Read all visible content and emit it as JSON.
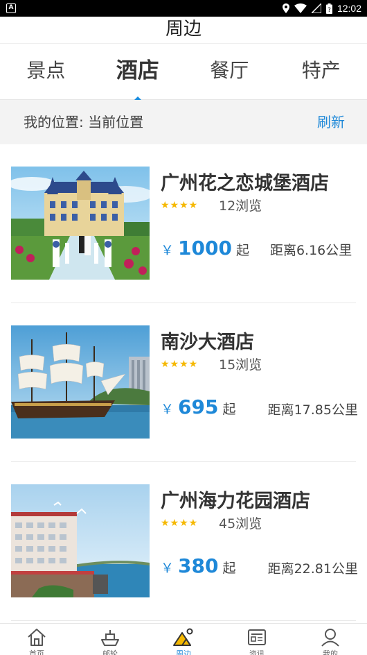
{
  "status_bar": {
    "time": "12:02",
    "app_icon": "A"
  },
  "header": {
    "title": "周边"
  },
  "tabs": [
    {
      "label": "景点",
      "active": false
    },
    {
      "label": "酒店",
      "active": true
    },
    {
      "label": "餐厅",
      "active": false
    },
    {
      "label": "特产",
      "active": false
    }
  ],
  "location": {
    "text": "我的位置: 当前位置",
    "refresh_label": "刷新"
  },
  "hotels": [
    {
      "name": "广州花之恋城堡酒店",
      "rating": 4,
      "views": "12浏览",
      "currency": "￥",
      "price": "1000",
      "price_suffix": "起",
      "distance": "距离6.16公里",
      "image": "castle-hotel-wedding-photo"
    },
    {
      "name": "南沙大酒店",
      "rating": 4,
      "views": "15浏览",
      "currency": "￥",
      "price": "695",
      "price_suffix": "起",
      "distance": "距离17.85公里",
      "image": "sailing-ship-photo"
    },
    {
      "name": "广州海力花园酒店",
      "rating": 4,
      "views": "45浏览",
      "currency": "￥",
      "price": "380",
      "price_suffix": "起",
      "distance": "距离22.81公里",
      "image": "seaside-hotel-photo"
    }
  ],
  "bottom_nav": [
    {
      "label": "首页",
      "icon": "home-icon",
      "active": false
    },
    {
      "label": "邮轮",
      "icon": "cruise-ship-icon",
      "active": false
    },
    {
      "label": "周边",
      "icon": "nearby-mountain-icon",
      "active": true
    },
    {
      "label": "资讯",
      "icon": "news-icon",
      "active": false
    },
    {
      "label": "我的",
      "icon": "user-icon",
      "active": false
    }
  ],
  "colors": {
    "accent": "#1e88d8",
    "star": "#f5b800",
    "location_bg": "#f3f3f3"
  }
}
